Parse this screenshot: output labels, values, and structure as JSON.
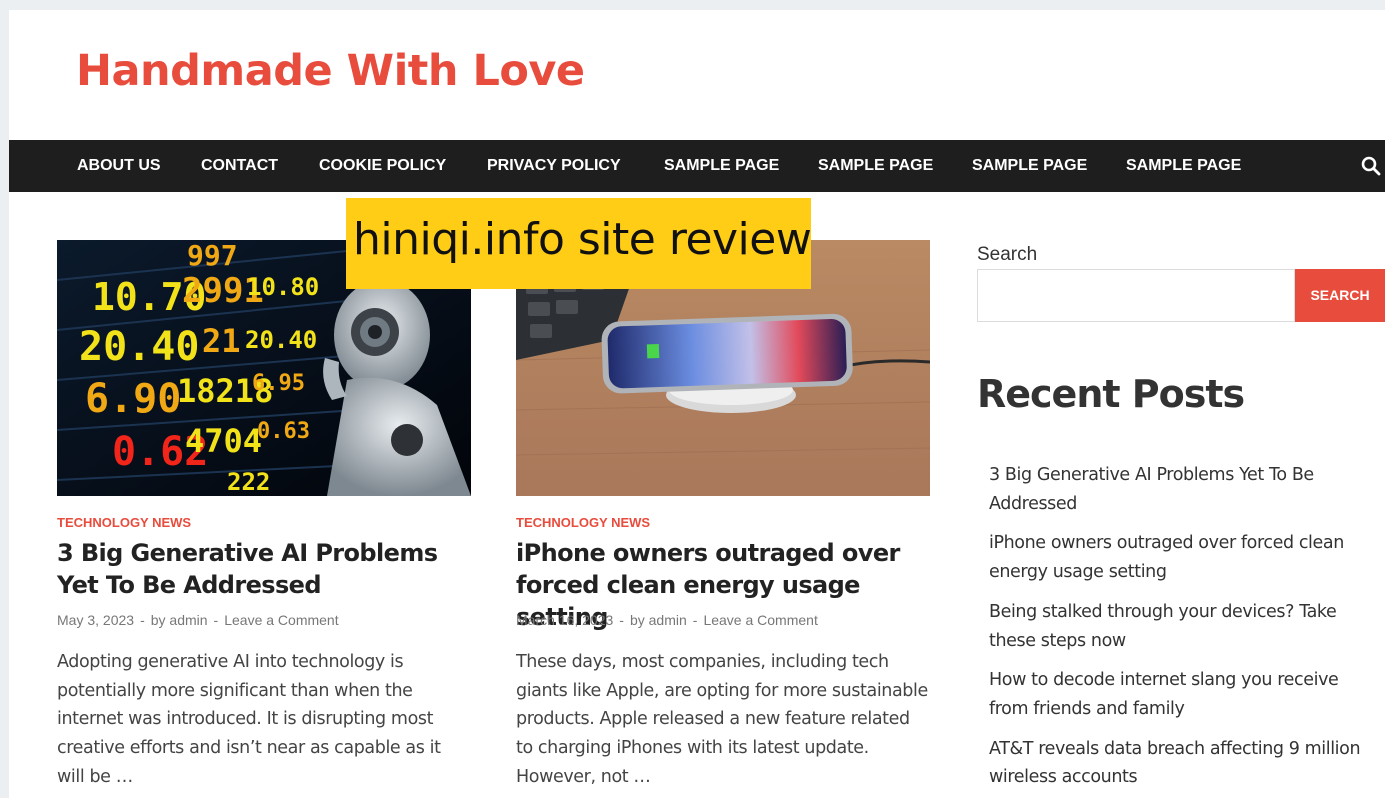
{
  "site": {
    "title": "Handmade With Love"
  },
  "nav": {
    "items": [
      {
        "label": "ABOUT US"
      },
      {
        "label": "CONTACT"
      },
      {
        "label": "COOKIE POLICY"
      },
      {
        "label": "PRIVACY POLICY"
      },
      {
        "label": "SAMPLE PAGE"
      },
      {
        "label": "SAMPLE PAGE"
      },
      {
        "label": "SAMPLE PAGE"
      },
      {
        "label": "SAMPLE PAGE"
      }
    ],
    "search_icon": "search-icon"
  },
  "banner": {
    "text": "hiniqi.info site review"
  },
  "posts": [
    {
      "category": "TECHNOLOGY NEWS",
      "title": "3 Big Generative AI Problems Yet To Be Addressed",
      "date": "May 3, 2023",
      "author": "by admin",
      "comments": "Leave a Comment",
      "excerpt": "Adopting generative AI into technology is potentially more significant than when the internet was introduced. It is disrupting most creative efforts and isn’t near as capable as it will be …"
    },
    {
      "category": "TECHNOLOGY NEWS",
      "title": "iPhone owners outraged over forced clean energy usage setting",
      "date": "March 16, 2023",
      "author": "by admin",
      "comments": "Leave a Comment",
      "excerpt": "These days, most companies, including tech giants like Apple, are opting for more sustainable products. Apple released a new feature related to charging iPhones with its latest update. However, not …"
    }
  ],
  "sidebar": {
    "search_label": "Search",
    "search_button": "SEARCH",
    "search_value": "",
    "recent_title": "Recent Posts",
    "recent_posts": [
      "3 Big Generative AI Problems Yet To Be Addressed",
      "iPhone owners outraged over forced clean energy usage setting",
      "Being stalked through your devices? Take these steps now",
      "How to decode internet slang you receive from friends and family",
      "AT&T reveals data breach affecting 9 million wireless accounts"
    ]
  },
  "colors": {
    "brand": "#e84c3d",
    "nav_bg": "#1e1e1e",
    "banner_bg": "#ffcc16"
  }
}
